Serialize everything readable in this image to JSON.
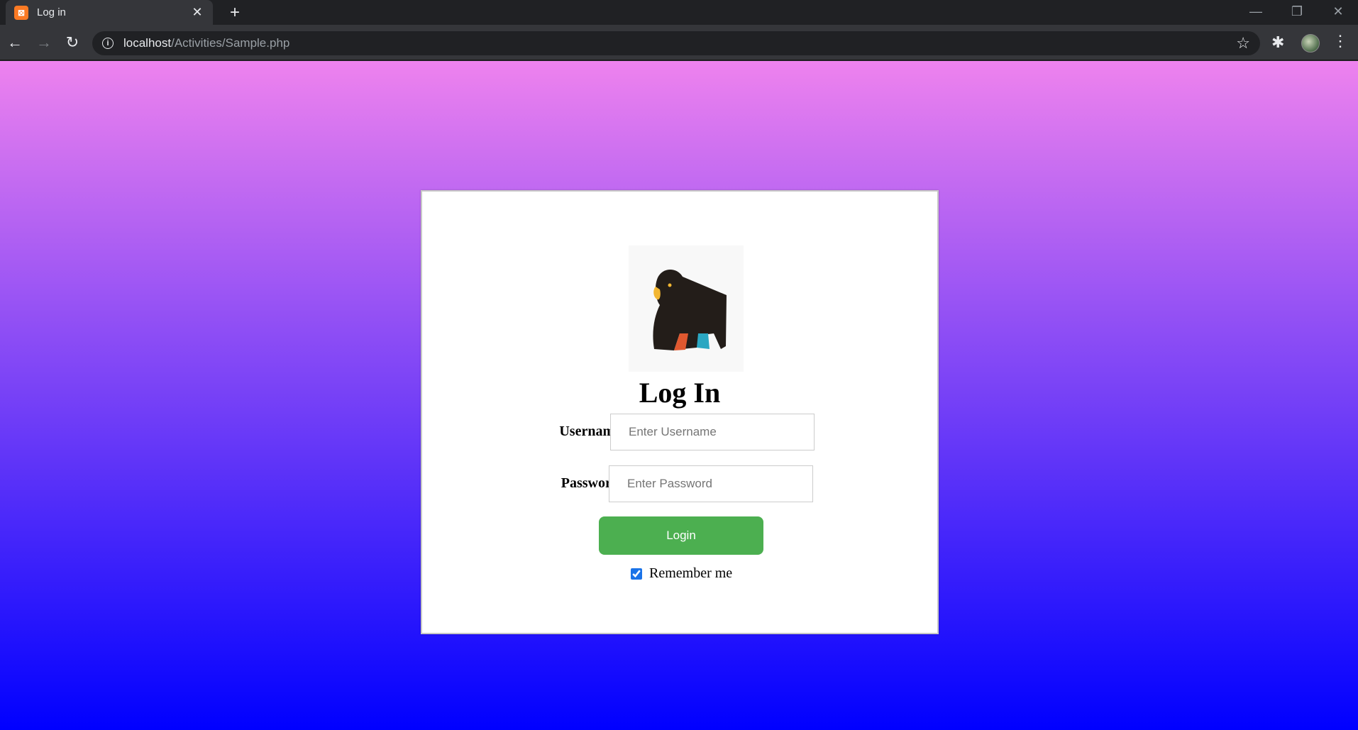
{
  "browser": {
    "tab_title": "Log in",
    "favicon_text": "⌘",
    "url_host": "localhost",
    "url_path": "/Activities/Sample.php",
    "icons": {
      "back": "back-arrow-icon",
      "forward": "forward-arrow-icon",
      "reload": "reload-icon",
      "site_info": "info-icon",
      "bookmark": "star-icon",
      "extensions": "puzzle-icon",
      "menu": "kebab-menu-icon"
    }
  },
  "page": {
    "background_colors": [
      "#ee82ee",
      "#0000ff"
    ],
    "logo": "gorilla-logo",
    "title": "Log In",
    "username_label": "Username",
    "username_placeholder": "Enter Username",
    "password_label": "Password",
    "password_placeholder": "Enter Password",
    "login_button": "Login",
    "login_button_color": "#4caf50",
    "remember_label": "Remember me",
    "remember_checked": true
  }
}
